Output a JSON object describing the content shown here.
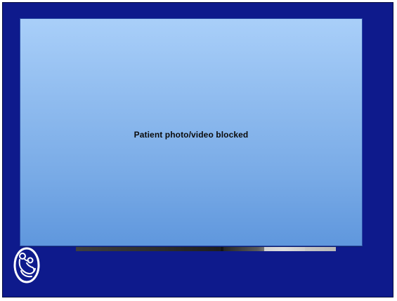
{
  "slide": {
    "placeholder_text": "Patient photo/video blocked"
  },
  "logo": {
    "icon": "mother-and-child-seal-icon"
  },
  "colors": {
    "slide_bg": "#0e1a8c",
    "panel_top": "#a9cff9",
    "panel_bottom": "#5f97dd",
    "logo_stroke": "#ffffff"
  }
}
